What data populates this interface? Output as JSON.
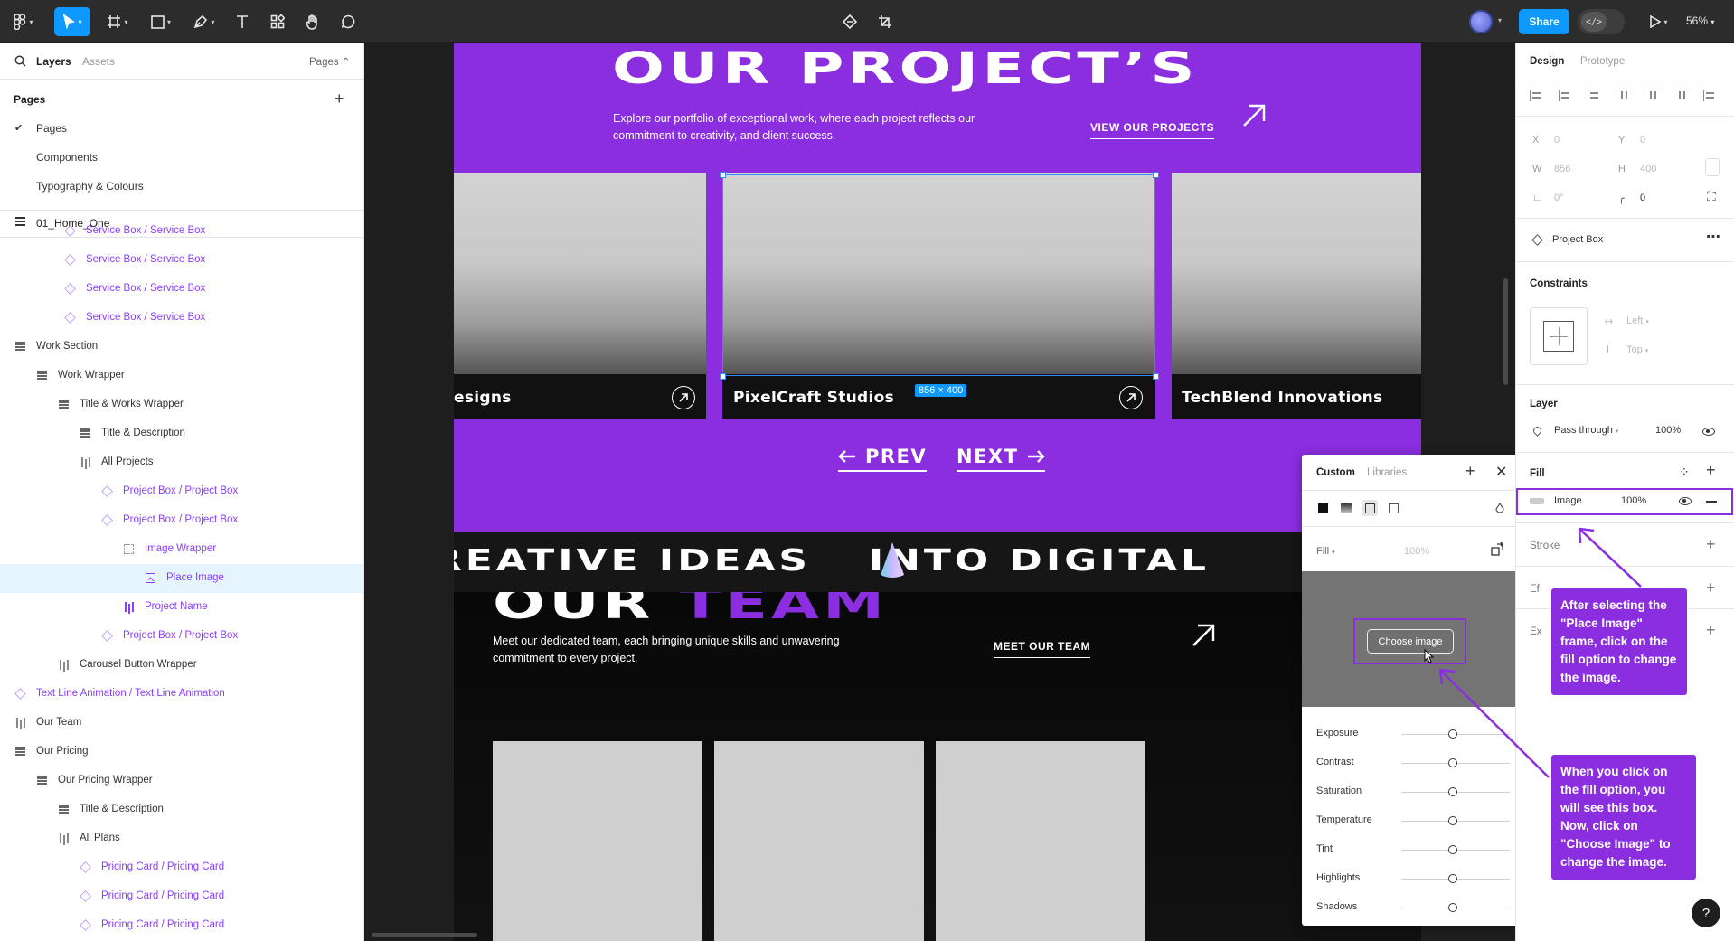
{
  "toolbar": {
    "zoom": "56%",
    "share_label": "Share",
    "dev_mode_glyph": "</>",
    "tools": [
      "figma-menu-icon",
      "move-tool-icon",
      "frame-tool-icon",
      "shape-tool-icon",
      "pen-tool-icon",
      "text-tool-icon",
      "resources-icon",
      "hand-tool-icon",
      "comment-icon"
    ],
    "accent": "#0d99ff"
  },
  "left_panel": {
    "tab_layers": "Layers",
    "tab_assets": "Assets",
    "pages_toggle": "Pages ⌃",
    "pages_header": "Pages",
    "pages": [
      {
        "label": "Pages",
        "current": true
      },
      {
        "label": "Components",
        "current": false
      },
      {
        "label": "Typography & Colours",
        "current": false
      }
    ],
    "current_frame": "01_Home_One",
    "layers": [
      {
        "label": "Service Box / Service Box",
        "icon": "component-icon"
      },
      {
        "label": "Service Box / Service Box",
        "icon": "component-icon"
      },
      {
        "label": "Service Box / Service Box",
        "icon": "component-icon"
      },
      {
        "label": "Service Box / Service Box",
        "icon": "component-icon"
      },
      {
        "label": "Work Section",
        "icon": "auto-layout-icon"
      },
      {
        "label": "Work Wrapper",
        "icon": "auto-layout-icon"
      },
      {
        "label": "Title & Works Wrapper",
        "icon": "auto-layout-icon"
      },
      {
        "label": "Title & Description",
        "icon": "auto-layout-icon"
      },
      {
        "label": "All Projects",
        "icon": "horizontal-layout-icon"
      },
      {
        "label": "Project Box / Project Box",
        "icon": "component-icon"
      },
      {
        "label": "Project Box / Project Box",
        "icon": "component-icon"
      },
      {
        "label": "Image Wrapper",
        "icon": "frame-icon"
      },
      {
        "label": "Place Image",
        "icon": "image-icon",
        "selected": true
      },
      {
        "label": "Project Name",
        "icon": "horizontal-layout-icon"
      },
      {
        "label": "Project Box / Project Box",
        "icon": "component-icon"
      },
      {
        "label": "Carousel Button Wrapper",
        "icon": "horizontal-layout-icon"
      },
      {
        "label": "Text Line Animation / Text Line Animation",
        "icon": "component-icon"
      },
      {
        "label": "Our Team",
        "icon": "horizontal-layout-icon"
      },
      {
        "label": "Our Pricing",
        "icon": "auto-layout-icon"
      },
      {
        "label": "Our Pricing Wrapper",
        "icon": "auto-layout-icon"
      },
      {
        "label": "Title & Description",
        "icon": "auto-layout-icon"
      },
      {
        "label": "All Plans",
        "icon": "horizontal-layout-icon"
      },
      {
        "label": "Pricing Card / Pricing Card",
        "icon": "component-icon"
      },
      {
        "label": "Pricing Card / Pricing Card",
        "icon": "component-icon"
      },
      {
        "label": "Pricing Card / Pricing Card",
        "icon": "component-icon"
      }
    ]
  },
  "canvas": {
    "projects_title": "OUR PROJECT’S",
    "projects_desc": "Explore our portfolio of exceptional work, where each project reflects our commitment to creativity, and client success.",
    "view_projects": "VIEW OUR PROJECTS",
    "projects": [
      {
        "name": "esigns"
      },
      {
        "name": "PixelCraft Studios"
      },
      {
        "name": "TechBlend Innovations"
      }
    ],
    "selection_size": "856 × 400",
    "prev": "PREV",
    "next": "NEXT",
    "marquee": "REATIVE IDEAS 🔺 INTO DIGITAL",
    "marquee_left": "REATIVE IDEAS",
    "marquee_right": "INTO DIGITAL",
    "team_title_a": "OUR",
    "team_title_b": "TEAM",
    "team_desc": "Meet our dedicated team, each bringing unique skills and unwavering commitment to every project.",
    "meet_team": "MEET OUR TEAM",
    "purple": "#8a2ee0"
  },
  "fill_popup": {
    "tab_custom": "Custom",
    "tab_libraries": "Libraries",
    "fill_label": "Fill",
    "fill_pct": "100%",
    "choose_image": "Choose image",
    "sliders": [
      "Exposure",
      "Contrast",
      "Saturation",
      "Temperature",
      "Tint",
      "Highlights",
      "Shadows"
    ]
  },
  "right_panel": {
    "tab_design": "Design",
    "tab_prototype": "Prototype",
    "x_label": "X",
    "x_val": "0",
    "y_label": "Y",
    "y_val": "0",
    "w_label": "W",
    "w_val": "856",
    "h_label": "H",
    "h_val": "400",
    "rot_val": "0°",
    "radius_val": "0",
    "component_name": "Project Box",
    "constraints_head": "Constraints",
    "constraint_h": "Left",
    "constraint_v": "Top",
    "layer_head": "Layer",
    "blend": "Pass through",
    "opacity": "100%",
    "fill_head": "Fill",
    "fill_type": "Image",
    "fill_opacity": "100%",
    "stroke_head": "Stroke",
    "effects_partial": "Ef",
    "export_partial": "Ex"
  },
  "annotations": {
    "note1": "After selecting the \"Place Image\" frame, click on the fill option to change the image.",
    "note2": "When you click on the fill option, you will see this box. Now, click on \"Choose Image\" to change the image."
  },
  "help": "?"
}
